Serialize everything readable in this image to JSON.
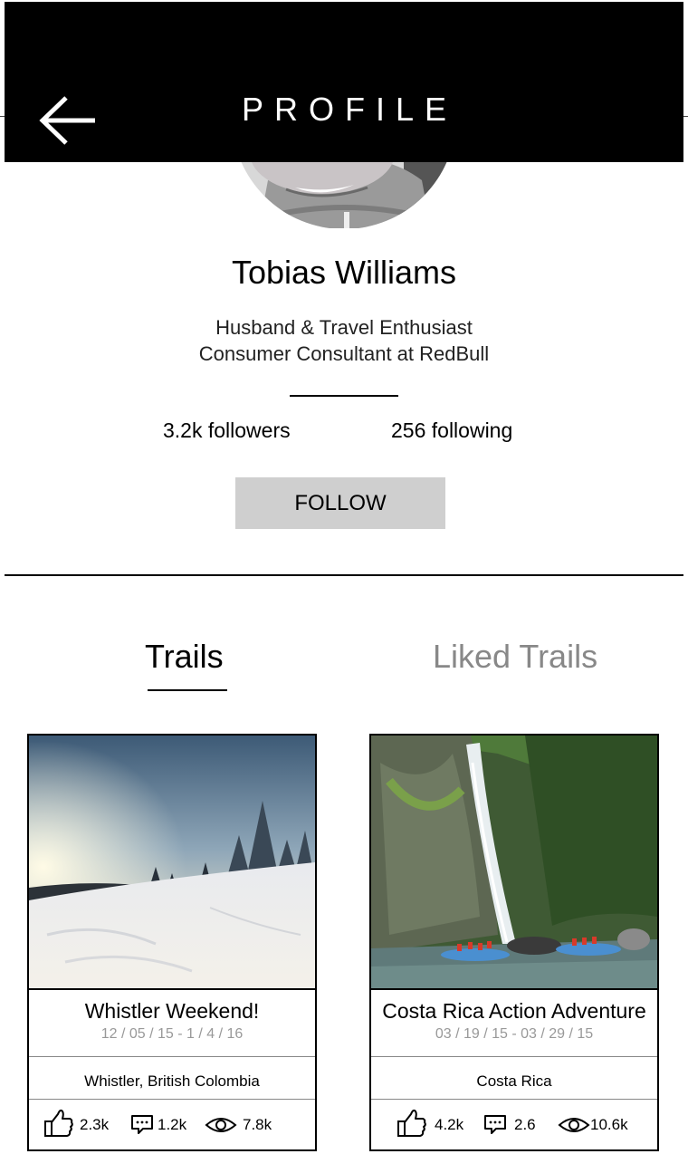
{
  "header": {
    "title": "PROFILE",
    "back_icon": "arrow-left-icon"
  },
  "profile": {
    "name": "Tobias Williams",
    "bio_line1": "Husband & Travel Enthusiast",
    "bio_line2": "Consumer Consultant at RedBull",
    "followers": "3.2k followers",
    "following": "256 following",
    "follow_label": "FOLLOW"
  },
  "tabs": [
    {
      "label": "Trails",
      "active": true
    },
    {
      "label": "Liked Trails",
      "active": false
    }
  ],
  "cards": [
    {
      "title": "Whistler Weekend!",
      "dates": "12 / 05 / 15 - 1 / 4 / 16",
      "location": "Whistler, British Colombia",
      "likes": "2.3k",
      "comments": "1.2k",
      "views": "7.8k"
    },
    {
      "title": "Costa Rica Action Adventure",
      "dates": "03 / 19 / 15 - 03 / 29 / 15",
      "location": "Costa Rica",
      "likes": "4.2k",
      "comments": "2.6",
      "views": "10.6k"
    }
  ],
  "icons": {
    "like": "thumbs-up-icon",
    "comment": "comment-icon",
    "view": "eye-icon"
  },
  "colors": {
    "header_bg": "#000000",
    "follow_bg": "#cfcfcf",
    "inactive_tab": "#888888",
    "date_text": "#999999"
  }
}
